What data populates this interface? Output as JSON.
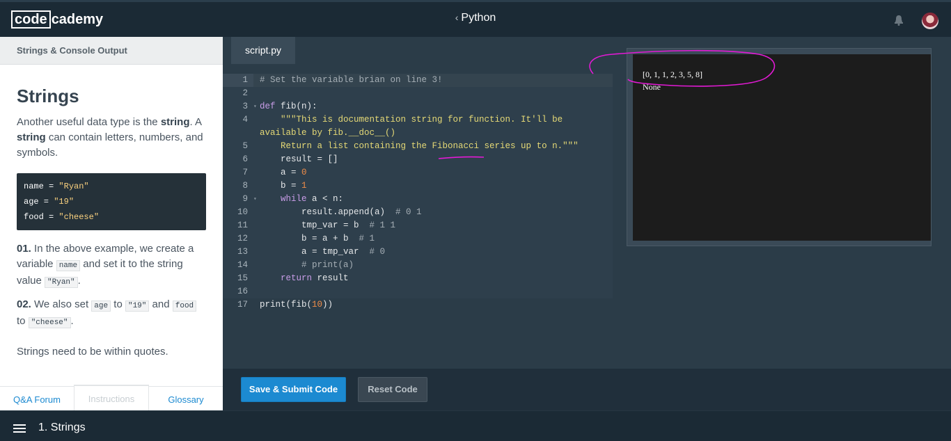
{
  "header": {
    "logo_box": "code",
    "logo_rest": "cademy",
    "course_title": "Python",
    "chevron": "‹",
    "bell_icon": "bell-icon"
  },
  "lesson": {
    "section_title": "Strings & Console Output",
    "heading": "Strings",
    "p1_a": "Another useful data type is the ",
    "p1_b": "string",
    "p1_c": ". A ",
    "p1_d": "string",
    "p1_e": " can contain letters, numbers, and symbols.",
    "code_lines": [
      {
        "key": "name",
        "val": "\"Ryan\""
      },
      {
        "key": "age",
        "val": "\"19\""
      },
      {
        "key": "food",
        "val": "\"cheese\""
      }
    ],
    "step1_num": "01.",
    "step1_a": " In the above example, we create a variable ",
    "step1_code1": "name",
    "step1_b": " and set it to the string value ",
    "step1_code2": "\"Ryan\"",
    "step1_c": ".",
    "step2_num": "02.",
    "step2_a": " We also set ",
    "step2_code1": "age",
    "step2_b": " to ",
    "step2_code2": "\"19\"",
    "step2_c": " and ",
    "step2_code3": "food",
    "step2_d": " to ",
    "step2_code4": "\"cheese\"",
    "step2_e": ".",
    "note": "Strings need to be within quotes.",
    "footer_tabs": [
      "Q&A Forum",
      "Instructions",
      "Glossary"
    ]
  },
  "editor": {
    "tab": "script.py",
    "line_numbers": [
      "1",
      "2",
      "3",
      "4",
      "",
      "5",
      "6",
      "7",
      "8",
      "9",
      "10",
      "11",
      "12",
      "13",
      "14",
      "15",
      "16",
      "17"
    ]
  },
  "output": {
    "line1": "[0, 1, 1, 2, 3, 5, 8]",
    "line2": "None"
  },
  "buttons": {
    "save": "Save & Submit Code",
    "reset": "Reset Code"
  },
  "footer": {
    "lesson_title": "1. Strings"
  },
  "colors": {
    "primary": "#1c8ad1",
    "annotation": "#e41ad6"
  }
}
